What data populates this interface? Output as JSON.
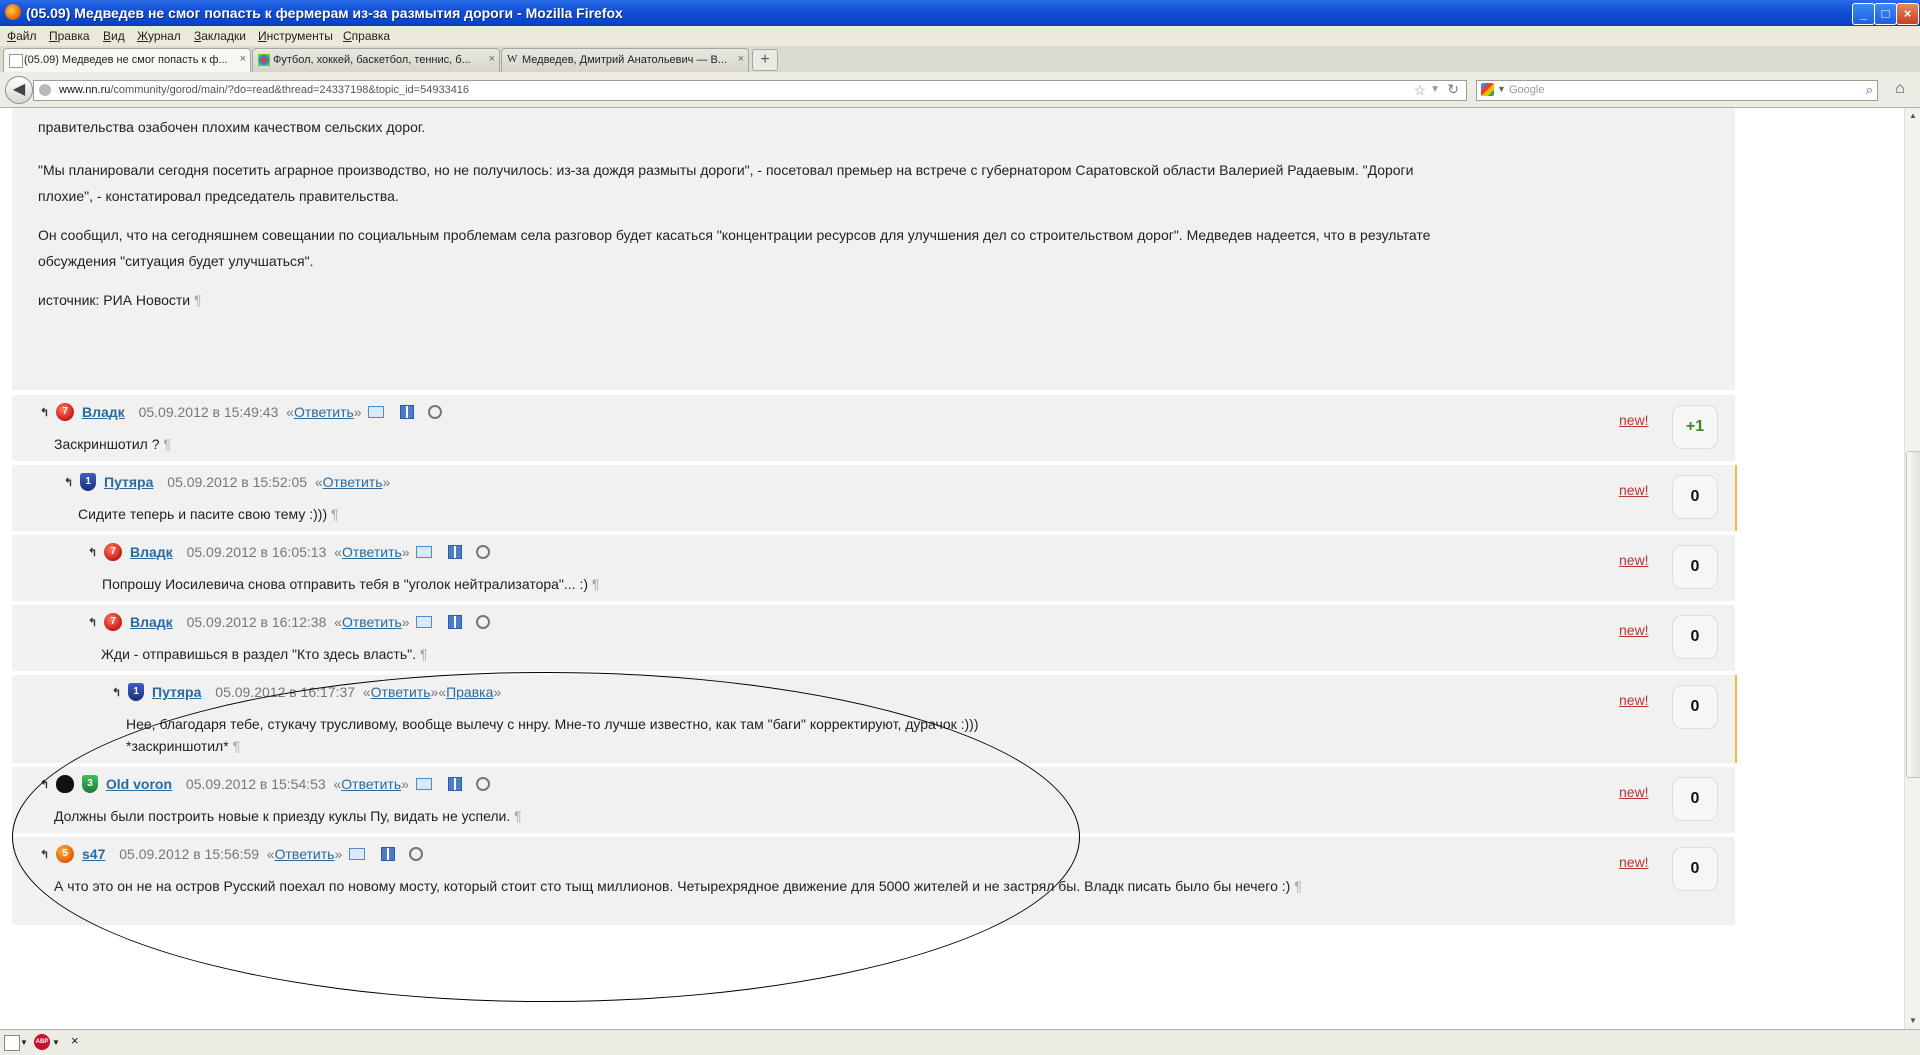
{
  "window": {
    "title": "(05.09) Медведев не смог попасть к фермерам из-за размытия дороги - Mozilla Firefox",
    "buttons": {
      "minimize": "_",
      "maximize": "□",
      "close": "×"
    }
  },
  "menu": [
    "Файл",
    "Правка",
    "Вид",
    "Журнал",
    "Закладки",
    "Инструменты",
    "Справка"
  ],
  "tabs": [
    {
      "label": "(05.09) Медведев не смог попасть к ф...",
      "icon": "page-icon",
      "active": true
    },
    {
      "label": "Футбол, хоккей, баскетбол, теннис, б...",
      "icon": "sports-icon",
      "active": false
    },
    {
      "label": "Медведев, Дмитрий Анатольевич — В...",
      "icon": "wikipedia-icon",
      "active": false
    }
  ],
  "tab_close": "×",
  "new_tab": "+",
  "nav": {
    "back": "◀",
    "url_domain": "www.nn.ru",
    "url_path": "/community/gorod/main/?do=read&thread=24337198&topic_id=54933416",
    "search_placeholder": "Google",
    "home": "⌂"
  },
  "article": {
    "paragraphs": [
      "правительства озабочен плохим качеством сельских дорог.",
      "\"Мы планировали сегодня посетить аграрное производство, но не получилось: из-за дождя размыты дороги\", - посетовал премьер на встрече с губернатором Саратовской области Валерией Радаевым. \"Дороги",
      "плохие\", - констатировал председатель правительства.",
      "Он сообщил, что на сегодняшнем совещании по социальным проблемам села разговор будет касаться \"концентрации ресурсов для улучшения дел со строительством дорог\". Медведев надеется, что в результате",
      "обсуждения \"ситуация будет улучшаться\".",
      "источник: РИА Новости"
    ],
    "pilcrow": "¶"
  },
  "reply_label": "Ответить",
  "edit_label": "Правка",
  "new_label": "new!",
  "comments": [
    {
      "user": "Владк",
      "badge": "7",
      "date": "05.09.2012 в 15:49:43",
      "text": "Заскриншотил ?",
      "score": "+1"
    },
    {
      "user": "Путяра",
      "badge": "1",
      "date": "05.09.2012 в 15:52:05",
      "text": "Сидите теперь и пасите свою тему :)))",
      "score": "0"
    },
    {
      "user": "Владк",
      "badge": "7",
      "date": "05.09.2012 в 16:05:13",
      "text": "Попрошу Иосилевича снова отправить тебя в \"уголок нейтрализатора\"... :)",
      "score": "0"
    },
    {
      "user": "Владк",
      "badge": "7",
      "date": "05.09.2012 в 16:12:38",
      "text": "Жди - отправишься в раздел \"Кто здесь власть\".",
      "score": "0"
    },
    {
      "user": "Путяра",
      "badge": "1",
      "date": "05.09.2012 в 16:17:37",
      "text": "Нее, благодаря тебе, стукачу трусливому, вообще вылечу с ннру. Мне-то лучше известно, как там \"баги\" корректируют, дурачок :)))",
      "text2": "*заскриншотил*",
      "score": "0"
    },
    {
      "user": "Old voron",
      "badge": "3",
      "date": "05.09.2012 в 15:54:53",
      "text": "Должны были построить новые к приезду куклы Пу, видать не успели.",
      "score": "0"
    },
    {
      "user": "s47",
      "badge": "5",
      "date": "05.09.2012 в 15:56:59",
      "text": "А что это он не на остров Русский поехал по новому мосту, который стоит сто тыщ миллионов. Четырехрядное движение для 5000 жителей и не застрял бы. Владк писать было бы нечего :)",
      "score": "0"
    }
  ],
  "statusbar": {
    "close": "×",
    "abp": "ABP"
  }
}
